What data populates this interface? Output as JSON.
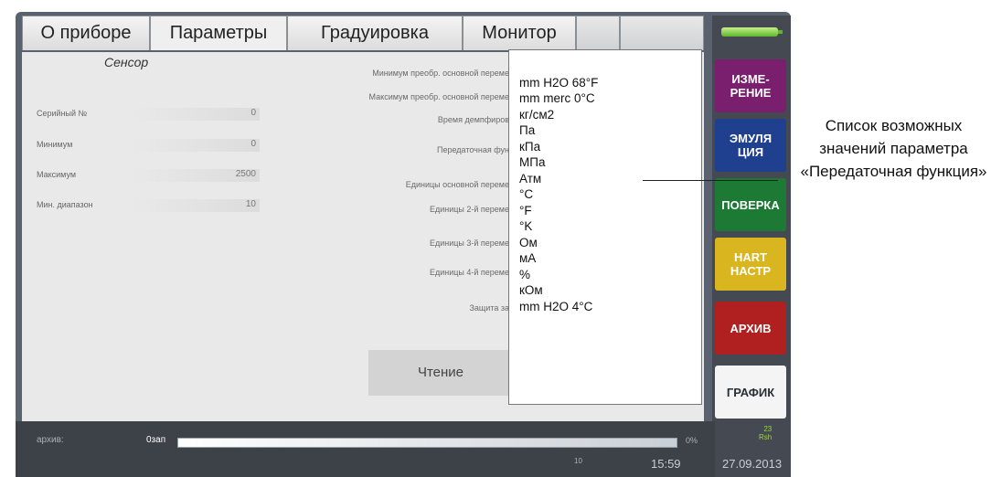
{
  "tabs": [
    {
      "label": "О приборе"
    },
    {
      "label": "Параметры"
    },
    {
      "label": "Градуировка"
    },
    {
      "label": "Монитор"
    }
  ],
  "sensor": {
    "title": "Сенсор",
    "rows": [
      {
        "label": "Серийный №",
        "value": "0"
      },
      {
        "label": "Минимум",
        "value": "0"
      },
      {
        "label": "Максимум",
        "value": "2500"
      },
      {
        "label": "Мин. диапазон",
        "value": "10"
      }
    ]
  },
  "params": [
    "Минимум преобр. основной переме",
    "Максимум преобр. основной переме",
    "Время демпфиров",
    "Передаточная фун",
    "Единицы основной переме",
    "Единицы 2-й переме",
    "Единицы 3-й переме",
    "Единицы 4-й переме",
    "Защита за"
  ],
  "read_button": "Чтение",
  "dropdown_items": [
    "mm H2O 68°F",
    "mm merc 0°C",
    "кг/см2",
    "Па",
    "кПа",
    "МПа",
    "Атм",
    "°C",
    "°F",
    "°K",
    "Ом",
    "мА",
    "%",
    "кОм",
    "mm H2O 4°C"
  ],
  "sidebar": [
    {
      "label": "ИЗМЕ-\nРЕНИЕ",
      "color": "#7a1e6e"
    },
    {
      "label": "ЭМУЛЯ\nЦИЯ",
      "color": "#1f3f8f"
    },
    {
      "label": "ПОВЕРКА",
      "color": "#1c7a34"
    },
    {
      "label": "HART\nНАСТР",
      "color": "#d9b520"
    },
    {
      "label": "АРХИВ",
      "color": "#b02020"
    },
    {
      "label": "ГРАФИК",
      "color": "#f4f4f4"
    }
  ],
  "status": {
    "archive_label": "архив:",
    "archive_count": "0зап",
    "percent": "0%",
    "temp": "23\nRsh",
    "extra": "10",
    "time": "15:59",
    "date": "27.09.2013"
  },
  "annotation": "Список возможных значений параметра «Передаточная функция»"
}
